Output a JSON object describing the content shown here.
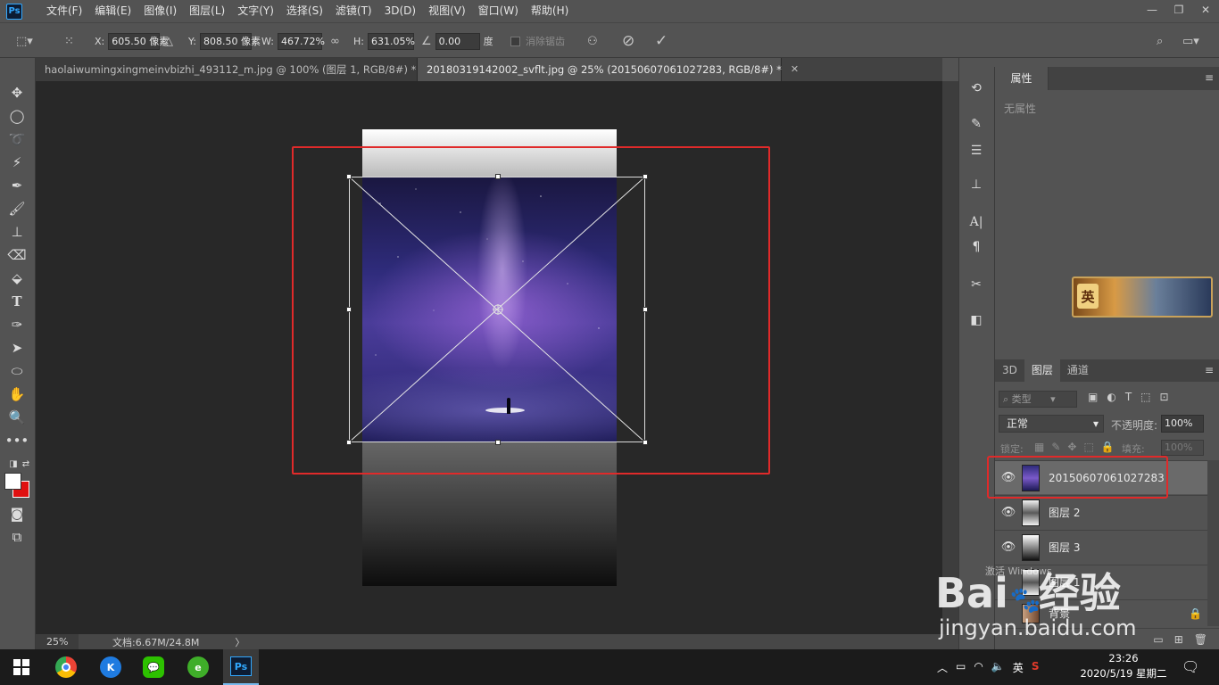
{
  "menubar": {
    "logo": "Ps",
    "items": [
      "文件(F)",
      "编辑(E)",
      "图像(I)",
      "图层(L)",
      "文字(Y)",
      "选择(S)",
      "滤镜(T)",
      "3D(D)",
      "视图(V)",
      "窗口(W)",
      "帮助(H)"
    ],
    "window_controls": [
      "—",
      "❐",
      "✕"
    ]
  },
  "options": {
    "x_label": "X:",
    "x_value": "605.50 像素",
    "y_label": "Y:",
    "y_value": "808.50 像素",
    "w_label": "W:",
    "w_value": "467.72%",
    "h_label": "H:",
    "h_value": "631.05%",
    "angle_value": "0.00",
    "angle_unit": "度",
    "antialias_label": "消除锯齿"
  },
  "tabs": [
    {
      "label": "haolaiwumingxingmeinvbizhi_493112_m.jpg @ 100% (图层 1, RGB/8#) *",
      "active": false
    },
    {
      "label": "20180319142002_svflt.jpg @ 25% (20150607061027283, RGB/8#) *",
      "active": true
    }
  ],
  "status": {
    "zoom": "25%",
    "doc_info": "文档:6.67M/24.8M",
    "arrow": "〉"
  },
  "properties": {
    "title": "属性",
    "empty_text": "无属性",
    "banner_char": "英"
  },
  "layers_panel": {
    "tabs": [
      "3D",
      "图层",
      "通道"
    ],
    "active_tab": "图层",
    "filter_label": "类型",
    "blend_mode": "正常",
    "opacity_label": "不透明度:",
    "opacity_value": "100%",
    "lock_label": "锁定:",
    "fill_label": "填充:",
    "fill_value": "100%",
    "layers": [
      {
        "name": "20150607061027283",
        "selected": true
      },
      {
        "name": "图层 2",
        "selected": false
      },
      {
        "name": "图层 3",
        "selected": false
      },
      {
        "name": "图层 1",
        "selected": false
      },
      {
        "name": "背景",
        "selected": false
      }
    ]
  },
  "taskbar": {
    "time": "23:26",
    "date": "2020/5/19 星期二",
    "ime": "英",
    "apps": [
      "chrome",
      "kugou",
      "wechat",
      "browser",
      "photoshop"
    ],
    "ps_label": "Ps",
    "k_label": "K"
  },
  "watermark": {
    "brand": "Bai",
    "brand2": "经验",
    "url": "jingyan.baidu.com",
    "overlay_text": "激活 Windows"
  },
  "colors": {
    "accent_red": "#e02a2a",
    "ps_blue": "#31a8ff",
    "panel_bg": "#535353",
    "canvas_bg": "#282828"
  }
}
